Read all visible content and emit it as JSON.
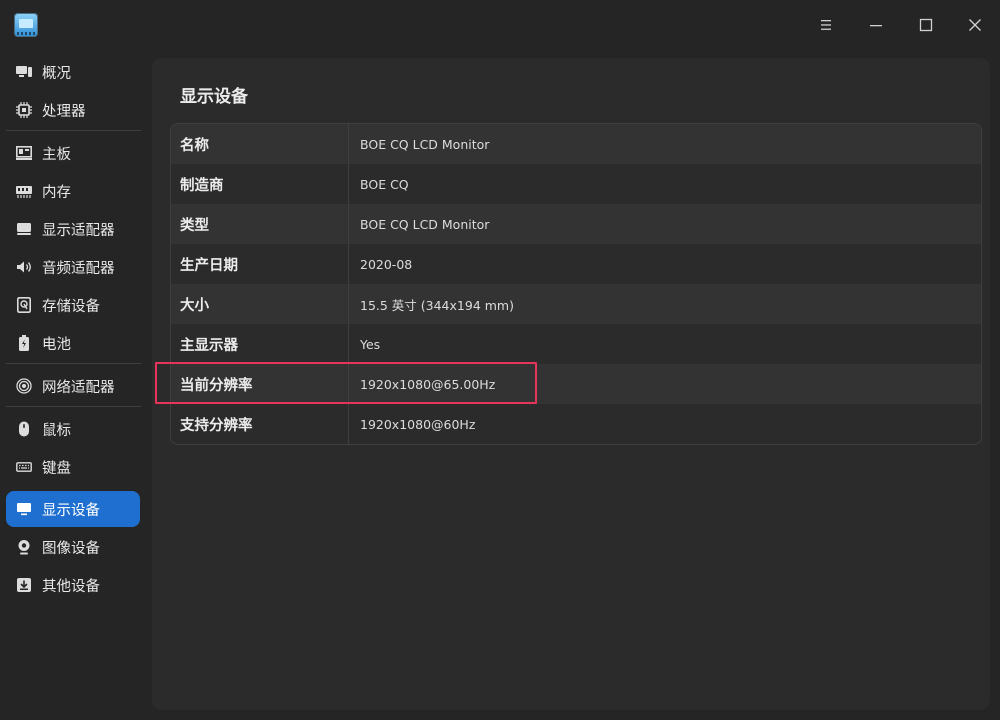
{
  "window": {
    "app_icon_text": "info"
  },
  "sidebar": {
    "items": [
      {
        "label": "概况",
        "icon": "overview-icon"
      },
      {
        "label": "处理器",
        "icon": "cpu-icon"
      },
      {
        "label": "主板",
        "icon": "motherboard-icon"
      },
      {
        "label": "内存",
        "icon": "memory-icon"
      },
      {
        "label": "显示适配器",
        "icon": "display-adapter-icon"
      },
      {
        "label": "音频适配器",
        "icon": "speaker-icon"
      },
      {
        "label": "存储设备",
        "icon": "storage-icon"
      },
      {
        "label": "电池",
        "icon": "battery-icon"
      },
      {
        "label": "网络适配器",
        "icon": "network-icon"
      },
      {
        "label": "鼠标",
        "icon": "mouse-icon"
      },
      {
        "label": "键盘",
        "icon": "keyboard-icon"
      },
      {
        "label": "显示设备",
        "icon": "monitor-icon"
      },
      {
        "label": "图像设备",
        "icon": "camera-icon"
      },
      {
        "label": "其他设备",
        "icon": "other-device-icon"
      }
    ],
    "active_index": 11
  },
  "main": {
    "title": "显示设备",
    "rows": [
      {
        "key": "名称",
        "value": "BOE CQ LCD Monitor"
      },
      {
        "key": "制造商",
        "value": "BOE CQ"
      },
      {
        "key": "类型",
        "value": "BOE CQ LCD Monitor"
      },
      {
        "key": "生产日期",
        "value": "2020-08"
      },
      {
        "key": "大小",
        "value": "15.5 英寸 (344x194 mm)"
      },
      {
        "key": "主显示器",
        "value": "Yes"
      },
      {
        "key": "当前分辨率",
        "value": "1920x1080@65.00Hz"
      },
      {
        "key": "支持分辨率",
        "value": "1920x1080@60Hz"
      }
    ]
  },
  "colors": {
    "accent": "#1e6fd0",
    "highlight_box": "#e8345a",
    "background": "#252525",
    "panel": "#2b2b2b"
  }
}
